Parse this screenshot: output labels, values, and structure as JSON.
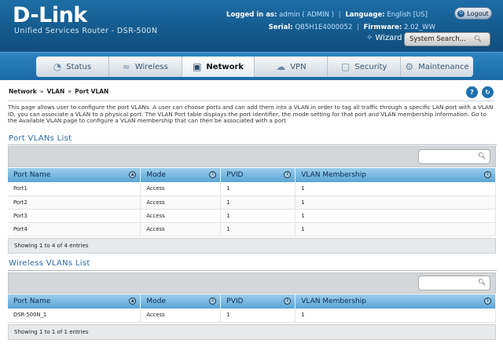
{
  "header": {
    "logo": "D-Link",
    "subtitle": "Unified Services Router - DSR-500N",
    "logged_in_label": "Logged in as:",
    "logged_in_value": "admin ( ADMIN )",
    "language_label": "Language:",
    "language_value": "English [US]",
    "logout_label": "Logout",
    "serial_label": "Serial:",
    "serial_value": "QB5H1E4000052",
    "firmware_label": "Firmware:",
    "firmware_value": "2.02_WW",
    "wizard_label": "Wizard",
    "search_placeholder": "System Search..."
  },
  "nav": {
    "items": [
      {
        "label": "Status",
        "icon": "gauge-icon"
      },
      {
        "label": "Wireless",
        "icon": "wifi-icon"
      },
      {
        "label": "Network",
        "icon": "monitor-icon",
        "active": true
      },
      {
        "label": "VPN",
        "icon": "cloud-lock-icon"
      },
      {
        "label": "Security",
        "icon": "lock-icon"
      },
      {
        "label": "Maintenance",
        "icon": "gears-icon"
      }
    ]
  },
  "breadcrumb": [
    "Network",
    "VLAN",
    "Port VLAN"
  ],
  "description": "This page allows user to configure the port VLANs. A user can choose ports and can add them into a VLAN.in order to tag all traffic through a specific LAN port with a VLAN ID, you can associate a VLAN to a physical port. The VLAN Port table displays the port identifier, the mode setting for that port and VLAN membership information. Go to the Available VLAN page to configure a VLAN membership that can then be associated with a port",
  "port_vlans": {
    "title": "Port VLANs List",
    "columns": [
      "Port Name",
      "Mode",
      "PVID",
      "VLAN Membership"
    ],
    "rows": [
      [
        "Port1",
        "Access",
        "1",
        "1"
      ],
      [
        "Port2",
        "Access",
        "1",
        "1"
      ],
      [
        "Port3",
        "Access",
        "1",
        "1"
      ],
      [
        "Port4",
        "Access",
        "1",
        "1"
      ]
    ],
    "footer": "Showing 1 to 4 of 4 entries"
  },
  "wireless_vlans": {
    "title": "Wireless VLANs List",
    "columns": [
      "Port Name",
      "Mode",
      "PVID",
      "VLAN Membership"
    ],
    "rows": [
      [
        "DSR-500N_1",
        "Access",
        "1",
        "1"
      ]
    ],
    "footer": "Showing 1 to 1 of 1 entries"
  },
  "colors": {
    "header_blue": "#155b8e",
    "nav_blue": "#1a6aa6",
    "section_title": "#2a6ba8",
    "grid_header": "#5aa5d6"
  }
}
